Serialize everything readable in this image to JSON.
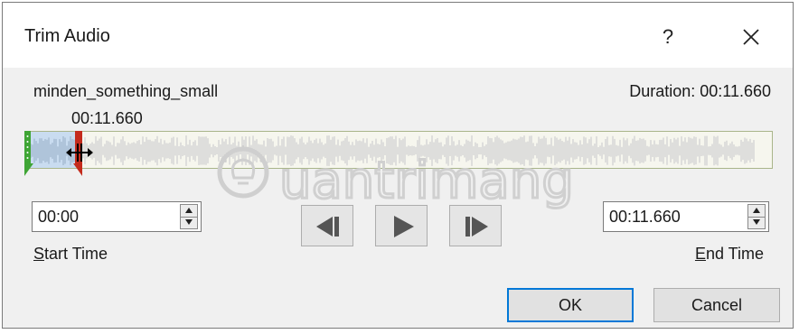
{
  "dialog": {
    "title": "Trim Audio",
    "help_label": "?",
    "close_icon": "close-icon"
  },
  "media": {
    "filename": "minden_something_small",
    "duration": "Duration: 00:11.660",
    "playhead_time": "00:11.660"
  },
  "trim": {
    "start_time_value": "00:00",
    "start_label_mnemonic": "S",
    "start_label_rest": "tart Time",
    "end_time_value": "00:11.660",
    "end_label_mnemonic": "E",
    "end_label_rest": "nd Time"
  },
  "playback": {
    "previous_frame_icon": "previous-frame-icon",
    "play_icon": "play-icon",
    "next_frame_icon": "next-frame-icon"
  },
  "buttons": {
    "ok_label": "OK",
    "cancel_label": "Cancel"
  },
  "watermark": {
    "text": "Quantrimang"
  },
  "colors": {
    "start_handle": "#3fa535",
    "end_handle": "#c42b1c",
    "selection": "#c9dcf0",
    "default_button_border": "#0078d7"
  }
}
